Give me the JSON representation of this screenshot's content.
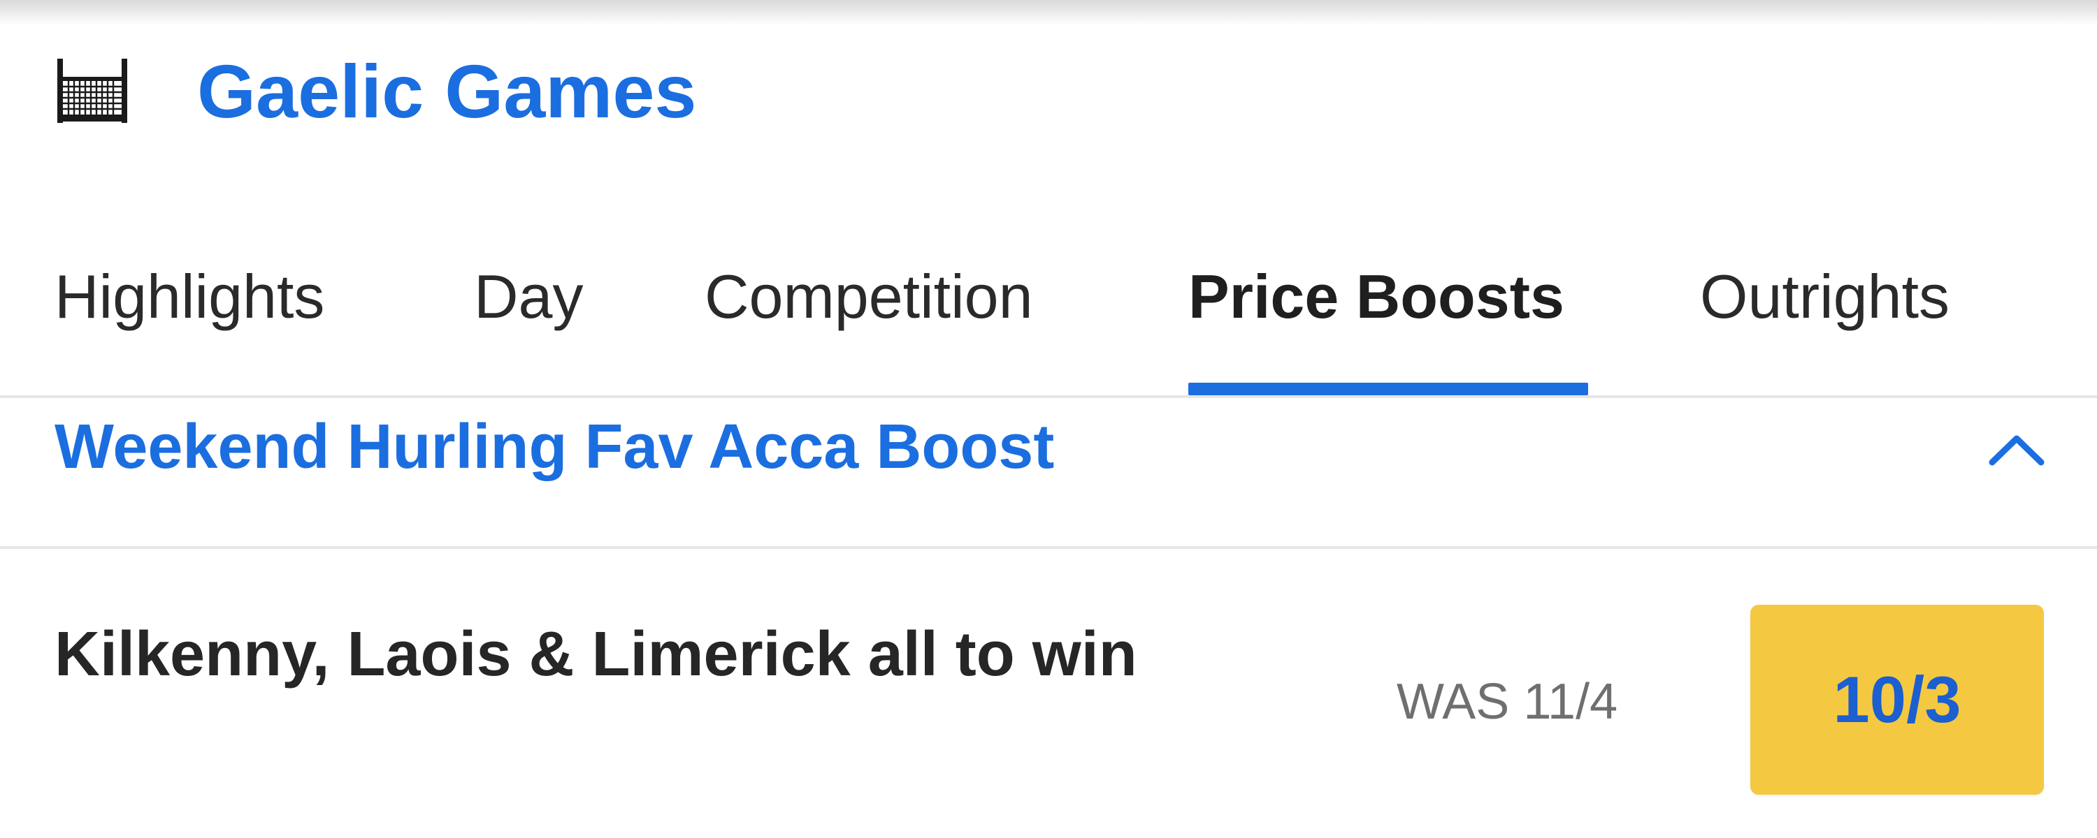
{
  "header": {
    "icon": "hurling-goal-icon",
    "title": "Gaelic Games"
  },
  "tabs": [
    {
      "label": "Highlights",
      "active": false
    },
    {
      "label": "Day",
      "active": false
    },
    {
      "label": "Competition",
      "active": false
    },
    {
      "label": "Price Boosts",
      "active": true
    },
    {
      "label": "Outrights",
      "active": false
    }
  ],
  "section": {
    "title": "Weekend Hurling Fav Acca Boost",
    "collapse_icon": "chevron-up-icon"
  },
  "selection": {
    "name": "Kilkenny, Laois & Limerick all to win",
    "was_price": "WAS 11/4",
    "boosted_price": "10/3"
  },
  "colors": {
    "accent": "#1b6ee0",
    "odds_button": "#f5c842"
  }
}
